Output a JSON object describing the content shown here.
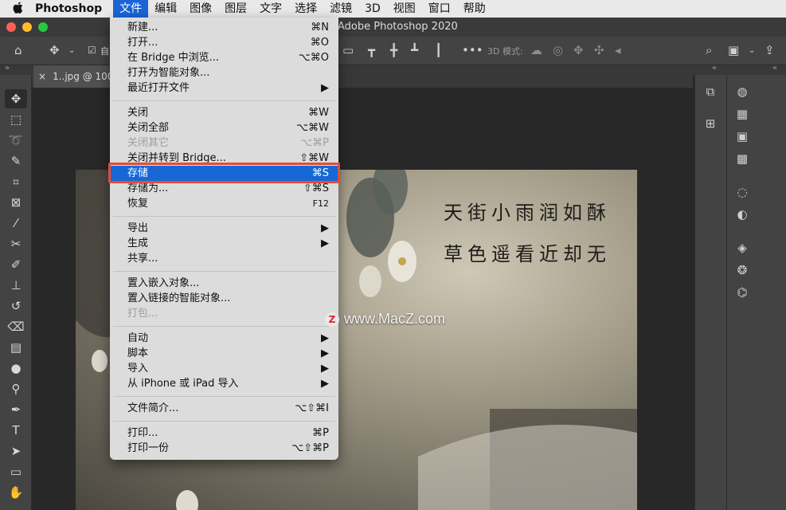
{
  "menubar": {
    "apple": "",
    "app_name": "Photoshop",
    "items": [
      "文件",
      "编辑",
      "图像",
      "图层",
      "文字",
      "选择",
      "滤镜",
      "3D",
      "视图",
      "窗口",
      "帮助"
    ]
  },
  "window": {
    "title": "Adobe Photoshop 2020",
    "traffic_colors": [
      "#fe5f57",
      "#febc2e",
      "#28c840"
    ]
  },
  "options": {
    "auto_label": "自",
    "mode_3d_label": "3D 模式:"
  },
  "document": {
    "tab_label": "1..jpg @ 100"
  },
  "file_menu": {
    "items": [
      {
        "label": "新建...",
        "shortcut": "⌘N"
      },
      {
        "label": "打开...",
        "shortcut": "⌘O"
      },
      {
        "label": "在 Bridge 中浏览...",
        "shortcut": "⌥⌘O"
      },
      {
        "label": "打开为智能对象...",
        "shortcut": ""
      },
      {
        "label": "最近打开文件",
        "shortcut": "▶"
      },
      {
        "label": "关闭",
        "shortcut": "⌘W"
      },
      {
        "label": "关闭全部",
        "shortcut": "⌥⌘W"
      },
      {
        "label": "关闭其它",
        "shortcut": "⌥⌘P"
      },
      {
        "label": "关闭并转到 Bridge...",
        "shortcut": "⇧⌘W"
      },
      {
        "label": "存储",
        "shortcut": "⌘S"
      },
      {
        "label": "存储为...",
        "shortcut": "⇧⌘S"
      },
      {
        "label": "恢复",
        "shortcut": "F12"
      },
      {
        "label": "导出",
        "shortcut": "▶"
      },
      {
        "label": "生成",
        "shortcut": "▶"
      },
      {
        "label": "共享...",
        "shortcut": ""
      },
      {
        "label": "置入嵌入对象...",
        "shortcut": ""
      },
      {
        "label": "置入链接的智能对象...",
        "shortcut": ""
      },
      {
        "label": "打包...",
        "shortcut": ""
      },
      {
        "label": "自动",
        "shortcut": "▶"
      },
      {
        "label": "脚本",
        "shortcut": "▶"
      },
      {
        "label": "导入",
        "shortcut": "▶"
      },
      {
        "label": "从 iPhone 或 iPad 导入",
        "shortcut": "▶"
      },
      {
        "label": "文件简介...",
        "shortcut": "⌥⇧⌘I"
      },
      {
        "label": "打印...",
        "shortcut": "⌘P"
      },
      {
        "label": "打印一份",
        "shortcut": "⌥⇧⌘P"
      }
    ]
  },
  "photo": {
    "poem_line1": "天街小雨润如酥",
    "poem_line2": "草色遥看近却无"
  },
  "watermark": {
    "logo": "Z",
    "text": "www.MacZ.com"
  },
  "colors": {
    "highlight": "#1768d6",
    "annotation_box": "#e24d37"
  }
}
